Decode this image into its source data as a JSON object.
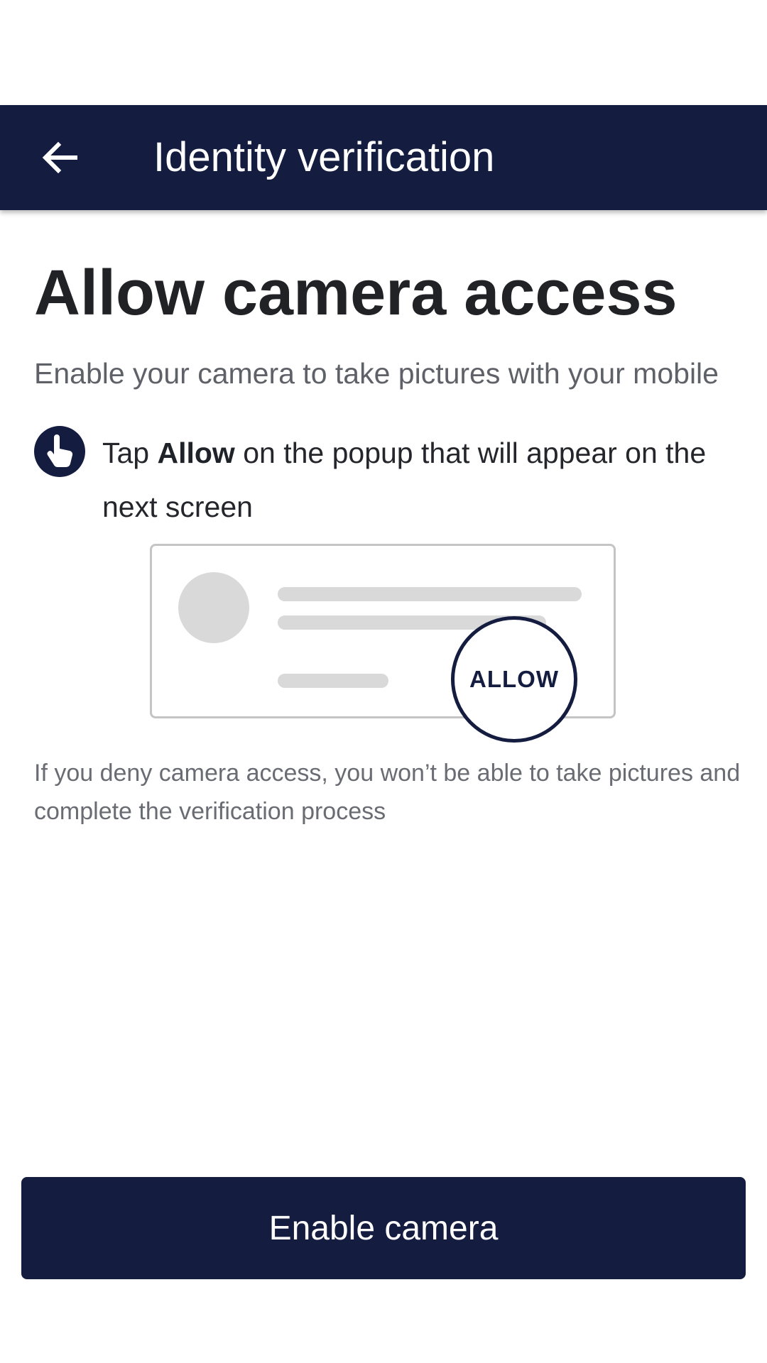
{
  "appbar": {
    "title": "Identity verification",
    "back_icon": "arrow-left-icon",
    "background": "#141c40"
  },
  "main": {
    "title": "Allow camera access",
    "subtitle": "Enable your camera to take pictures with your mobile",
    "instruction": {
      "icon": "hand-pointer-icon",
      "prefix": "Tap ",
      "emphasis": "Allow",
      "suffix": " on the popup that will appear on the next screen"
    },
    "illustration": {
      "allow_label": "ALLOW"
    },
    "note": "If you deny camera access, you won’t be able to take pictures and complete the verification process"
  },
  "footer": {
    "button_label": "Enable camera"
  },
  "colors": {
    "primary": "#141c40",
    "text": "#202226",
    "muted": "#5f6168",
    "placeholder": "#d9d9d9"
  }
}
